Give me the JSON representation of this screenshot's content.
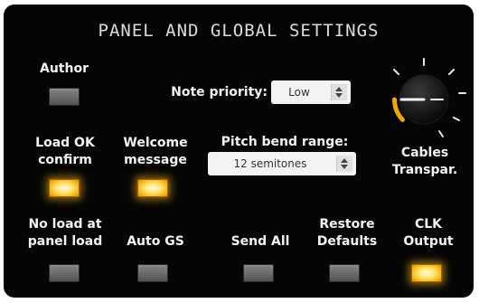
{
  "panel": {
    "title": "PANEL AND GLOBAL SETTINGS"
  },
  "author": {
    "label": "Author",
    "state": "off"
  },
  "note_priority": {
    "label": "Note priority:",
    "value": "Low"
  },
  "pitch_bend": {
    "label": "Pitch bend range:",
    "value": "12 semitones"
  },
  "cables_transparency": {
    "label_line1": "Cables",
    "label_line2": "Transpar.",
    "level_fraction": 0.25
  },
  "load_ok_confirm": {
    "label_line1": "Load OK",
    "label_line2": "confirm",
    "state": "on"
  },
  "welcome_message": {
    "label_line1": "Welcome",
    "label_line2": "message",
    "state": "on"
  },
  "no_load_at_panel_load": {
    "label_line1": "No load at",
    "label_line2": "panel load",
    "state": "off"
  },
  "auto_gs": {
    "label": "Auto GS",
    "state": "off"
  },
  "send_all": {
    "label": "Send All",
    "state": "off"
  },
  "restore_defaults": {
    "label_line1": "Restore",
    "label_line2": "Defaults",
    "state": "off"
  },
  "clk_output": {
    "label_line1": "CLK",
    "label_line2": "Output",
    "state": "on"
  },
  "colors": {
    "led_on": "#ffcc33",
    "arc": "#f0a500",
    "panel": "#050505"
  }
}
